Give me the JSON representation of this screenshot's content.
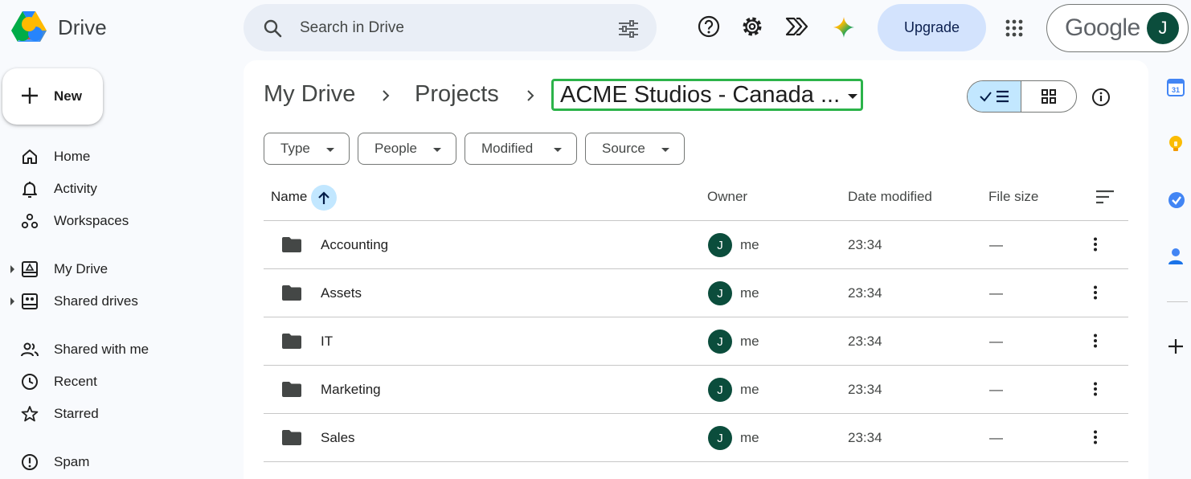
{
  "app": {
    "name": "Drive",
    "colors": {
      "accent": "#c2e7ff",
      "selection_outline": "#2cb34a",
      "avatar": "#0b4d3c",
      "upgrade_bg": "#d3e3fd"
    }
  },
  "topbar": {
    "search_placeholder": "Search in Drive",
    "upgrade_label": "Upgrade",
    "account_brand": "Google",
    "account_initial": "J",
    "icons": [
      "search-icon",
      "tune-icon",
      "help-icon",
      "settings-icon",
      "shortcut-icon",
      "gemini-icon",
      "apps-grid-icon"
    ]
  },
  "sidebar": {
    "new_label": "New",
    "items": [
      {
        "label": "Home",
        "icon": "home-icon"
      },
      {
        "label": "Activity",
        "icon": "bell-icon"
      },
      {
        "label": "Workspaces",
        "icon": "workspaces-icon"
      },
      {
        "label": "My Drive",
        "icon": "my-drive-icon"
      },
      {
        "label": "Shared drives",
        "icon": "shared-drives-icon"
      },
      {
        "label": "Shared with me",
        "icon": "people-icon"
      },
      {
        "label": "Recent",
        "icon": "clock-icon"
      },
      {
        "label": "Starred",
        "icon": "star-icon"
      },
      {
        "label": "Spam",
        "icon": "spam-icon"
      }
    ]
  },
  "breadcrumb": {
    "items": [
      "My Drive",
      "Projects"
    ],
    "current": "ACME Studios - Canada ..."
  },
  "filters": [
    "Type",
    "People",
    "Modified",
    "Source"
  ],
  "table": {
    "columns": {
      "name": "Name",
      "owner": "Owner",
      "modified": "Date modified",
      "size": "File size"
    },
    "rows": [
      {
        "name": "Accounting",
        "owner_initial": "J",
        "owner": "me",
        "modified": "23:34",
        "size": "—"
      },
      {
        "name": "Assets",
        "owner_initial": "J",
        "owner": "me",
        "modified": "23:34",
        "size": "—"
      },
      {
        "name": "IT",
        "owner_initial": "J",
        "owner": "me",
        "modified": "23:34",
        "size": "—"
      },
      {
        "name": "Marketing",
        "owner_initial": "J",
        "owner": "me",
        "modified": "23:34",
        "size": "—"
      },
      {
        "name": "Sales",
        "owner_initial": "J",
        "owner": "me",
        "modified": "23:34",
        "size": "—"
      }
    ]
  },
  "side_panel": {
    "calendar_day": "31",
    "icons": [
      "calendar-icon",
      "keep-icon",
      "tasks-icon",
      "contacts-icon",
      "add-icon"
    ]
  }
}
